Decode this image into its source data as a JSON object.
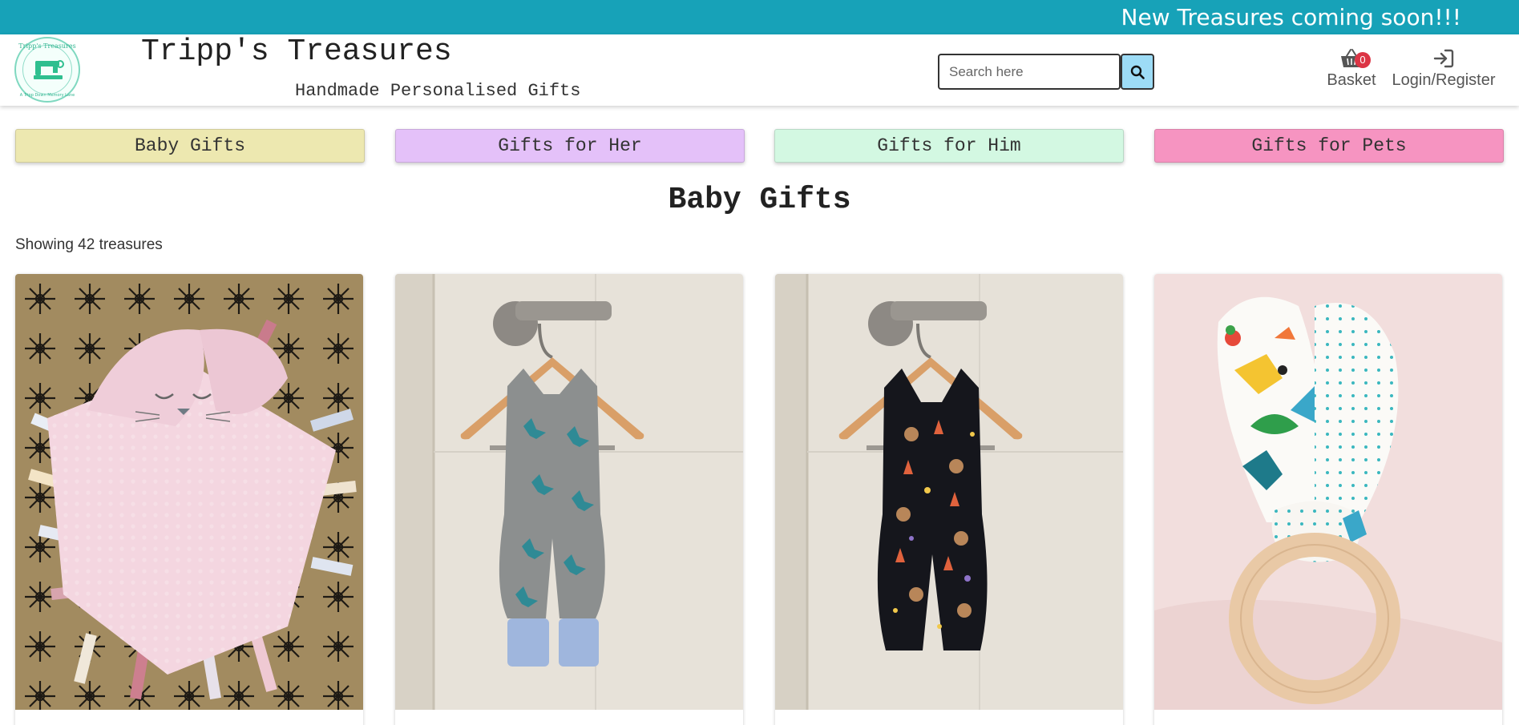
{
  "banner": {
    "text": "New Treasures coming soon!!!"
  },
  "brand": {
    "title": "Tripp's Treasures",
    "subtitle": "Handmade Personalised Gifts",
    "logo_text_top": "Tripp's Treasures",
    "logo_text_bottom": "A Tripp Down Memory Lane"
  },
  "search": {
    "placeholder": "Search here",
    "value": "",
    "icon": "search-icon"
  },
  "nav": {
    "basket": {
      "label": "Basket",
      "count": "0",
      "icon": "basket-icon"
    },
    "login": {
      "label": "Login/Register",
      "icon": "sign-in-icon"
    }
  },
  "categories": [
    {
      "label": "Baby Gifts",
      "color": "#ede8b0"
    },
    {
      "label": "Gifts for Her",
      "color": "#e4c1f9"
    },
    {
      "label": "Gifts for Him",
      "color": "#d3f8e2"
    },
    {
      "label": "Gifts for Pets",
      "color": "#f694c1"
    }
  ],
  "page": {
    "title": "Baby Gifts",
    "result_count": "Showing 42 treasures"
  },
  "colors": {
    "banner": "#17a2b8",
    "search_button": "#9ddcf6",
    "badge": "#dc3545"
  }
}
